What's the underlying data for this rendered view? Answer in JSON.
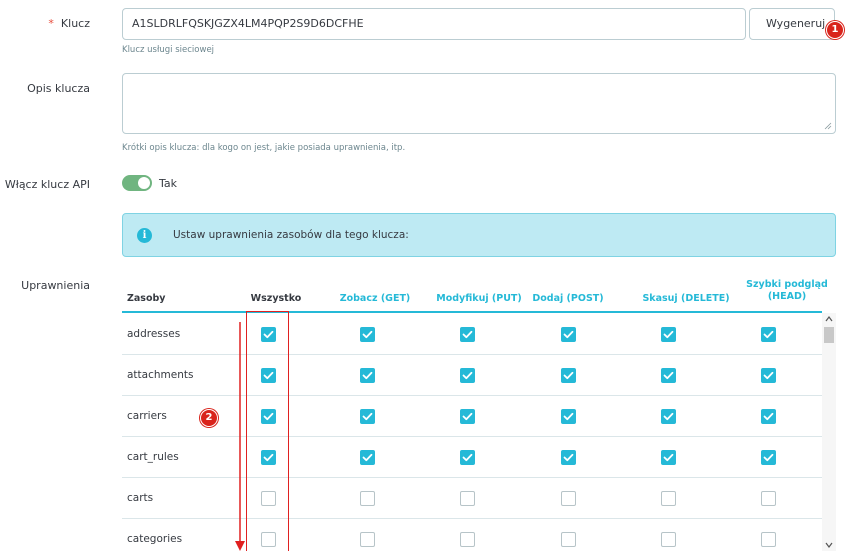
{
  "form": {
    "key_label": "Klucz",
    "key_required_mark": "*",
    "key_value": "A1SLDRLFQSKJGZX4LM4PQP2S9D6DCFHE",
    "generate_button": "Wygeneruj",
    "key_help": "Klucz usługi sieciowej",
    "desc_label": "Opis klucza",
    "desc_value": "",
    "desc_help": "Krótki opis klucza: dla kogo on jest, jakie posiada uprawnienia, itp.",
    "enable_label": "Włącz klucz API",
    "enable_state": "Tak",
    "info_message": "Ustaw uprawnienia zasobów dla tego klucza:",
    "permissions_label": "Uprawnienia"
  },
  "table": {
    "headers": {
      "resources": "Zasoby",
      "all": "Wszystko",
      "get": "Zobacz (GET)",
      "put": "Modyfikuj (PUT)",
      "post": "Dodaj (POST)",
      "delete": "Skasuj (DELETE)",
      "head_line1": "Szybki podgląd",
      "head_line2": "(HEAD)"
    },
    "rows": [
      {
        "name": "addresses",
        "checked": [
          true,
          true,
          true,
          true,
          true,
          true
        ]
      },
      {
        "name": "attachments",
        "checked": [
          true,
          true,
          true,
          true,
          true,
          true
        ]
      },
      {
        "name": "carriers",
        "checked": [
          true,
          true,
          true,
          true,
          true,
          true
        ]
      },
      {
        "name": "cart_rules",
        "checked": [
          true,
          true,
          true,
          true,
          true,
          true
        ]
      },
      {
        "name": "carts",
        "checked": [
          false,
          false,
          false,
          false,
          false,
          false
        ]
      },
      {
        "name": "categories",
        "checked": [
          false,
          false,
          false,
          false,
          false,
          false
        ]
      }
    ]
  },
  "annotations": {
    "marker1": "1",
    "marker2": "2"
  },
  "colors": {
    "accent": "#25b9d7",
    "toggle_on": "#70b580",
    "info_bg": "#beeaf3",
    "annotation_red": "#d9241c"
  }
}
